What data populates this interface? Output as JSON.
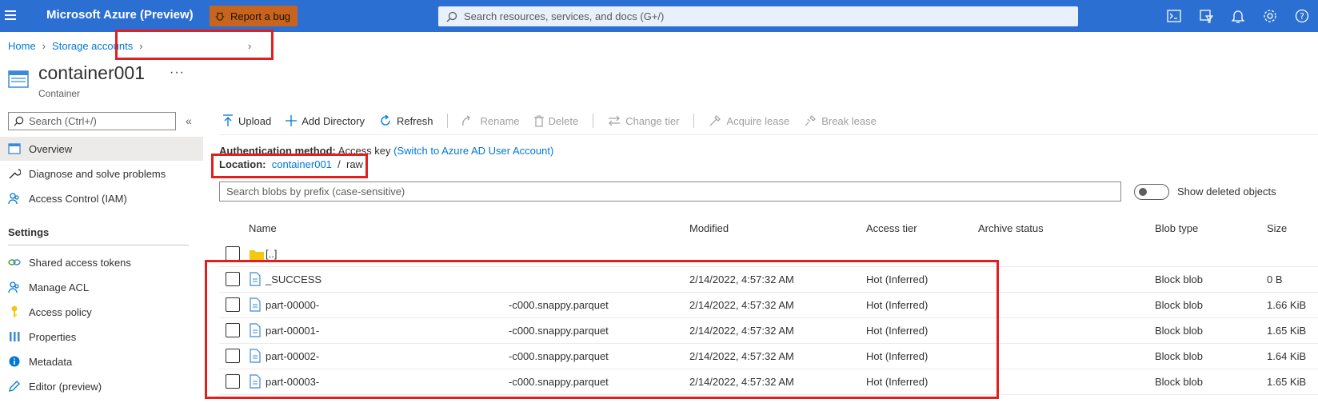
{
  "topbar": {
    "brand": "Microsoft Azure (Preview)",
    "bug_button": "Report a bug",
    "search_placeholder": "Search resources, services, and docs (G+/)",
    "icons": [
      "cloud-shell-icon",
      "directory-filter-icon",
      "notifications-icon",
      "settings-icon",
      "help-icon"
    ]
  },
  "breadcrumb": {
    "home": "Home",
    "storage_accounts": "Storage accounts"
  },
  "header": {
    "title": "container001",
    "more": "···",
    "subtitle": "Container"
  },
  "sidebar": {
    "search_placeholder": "Search (Ctrl+/)",
    "collapse": "«",
    "items": [
      {
        "label": "Overview",
        "icon": "overview-icon"
      },
      {
        "label": "Diagnose and solve problems",
        "icon": "wrench-icon"
      },
      {
        "label": "Access Control (IAM)",
        "icon": "people-icon"
      }
    ],
    "section_settings": "Settings",
    "settings_items": [
      {
        "label": "Shared access tokens",
        "icon": "link-icon"
      },
      {
        "label": "Manage ACL",
        "icon": "people-icon"
      },
      {
        "label": "Access policy",
        "icon": "key-icon"
      },
      {
        "label": "Properties",
        "icon": "properties-icon"
      },
      {
        "label": "Metadata",
        "icon": "info-icon"
      },
      {
        "label": "Editor (preview)",
        "icon": "pencil-icon"
      }
    ]
  },
  "toolbar": {
    "upload": "Upload",
    "add_directory": "Add Directory",
    "refresh": "Refresh",
    "rename": "Rename",
    "delete": "Delete",
    "change_tier": "Change tier",
    "acquire_lease": "Acquire lease",
    "break_lease": "Break lease"
  },
  "info": {
    "auth_label": "Authentication method:",
    "auth_value": "Access key",
    "auth_link": "(Switch to Azure AD User Account)",
    "location_label": "Location:",
    "location_container": "container001",
    "location_sep": "/",
    "location_folder": "raw"
  },
  "blob_search_placeholder": "Search blobs by prefix (case-sensitive)",
  "show_deleted_label": "Show deleted objects",
  "table": {
    "headers": {
      "name": "Name",
      "modified": "Modified",
      "access_tier": "Access tier",
      "archive_status": "Archive status",
      "blob_type": "Blob type",
      "size": "Size"
    },
    "parent_row": "[..]",
    "rows": [
      {
        "name": "_SUCCESS",
        "suffix": "",
        "modified": "2/14/2022, 4:57:32 AM",
        "tier": "Hot (Inferred)",
        "type": "Block blob",
        "size": "0 B"
      },
      {
        "name": "part-00000-",
        "suffix": "-c000.snappy.parquet",
        "modified": "2/14/2022, 4:57:32 AM",
        "tier": "Hot (Inferred)",
        "type": "Block blob",
        "size": "1.66 KiB"
      },
      {
        "name": "part-00001-",
        "suffix": "-c000.snappy.parquet",
        "modified": "2/14/2022, 4:57:32 AM",
        "tier": "Hot (Inferred)",
        "type": "Block blob",
        "size": "1.65 KiB"
      },
      {
        "name": "part-00002-",
        "suffix": "-c000.snappy.parquet",
        "modified": "2/14/2022, 4:57:32 AM",
        "tier": "Hot (Inferred)",
        "type": "Block blob",
        "size": "1.64 KiB"
      },
      {
        "name": "part-00003-",
        "suffix": "-c000.snappy.parquet",
        "modified": "2/14/2022, 4:57:32 AM",
        "tier": "Hot (Inferred)",
        "type": "Block blob",
        "size": "1.65 KiB"
      }
    ]
  },
  "colors": {
    "topbar": "#2a6fd1",
    "bug_button": "#c8641e",
    "link": "#0078d4",
    "annotation": "#e0201f"
  }
}
